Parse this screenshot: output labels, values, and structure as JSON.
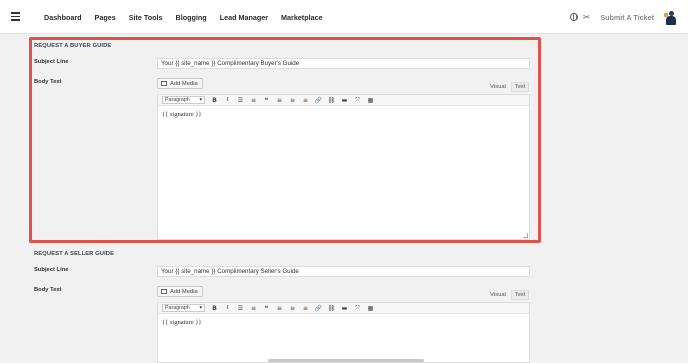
{
  "nav": {
    "items": [
      "Dashboard",
      "Pages",
      "Site Tools",
      "Blogging",
      "Lead Manager",
      "Marketplace"
    ],
    "submit_ticket": "Submit A Ticket"
  },
  "buyer_guide": {
    "title": "REQUEST A BUYER GUIDE",
    "subject_label": "Subject Line",
    "subject_value": "Your {{ site_name }} Complimentary Buyer's Guide",
    "body_label": "Body Text",
    "body_content": "{{ signature }}"
  },
  "seller_guide": {
    "title": "REQUEST A SELLER GUIDE",
    "subject_label": "Subject Line",
    "subject_value": "Your {{ site_name }} Complimentary Seller's Guide",
    "body_label": "Body Text",
    "body_content": "{{ signature }}"
  },
  "editor": {
    "add_media": "Add Media",
    "tab_visual": "Visual",
    "tab_text": "Text",
    "format_select": "Paragraph",
    "toolbar_icons": [
      "bold-icon",
      "italic-icon",
      "bullet-list-icon",
      "numbered-list-icon",
      "blockquote-icon",
      "align-left-icon",
      "align-center-icon",
      "align-right-icon",
      "link-icon",
      "unlink-icon",
      "read-more-icon",
      "fullscreen-icon",
      "toolbar-toggle-icon"
    ]
  },
  "colors": {
    "highlight": "#e0514a",
    "section_title": "#3b4a5a"
  }
}
